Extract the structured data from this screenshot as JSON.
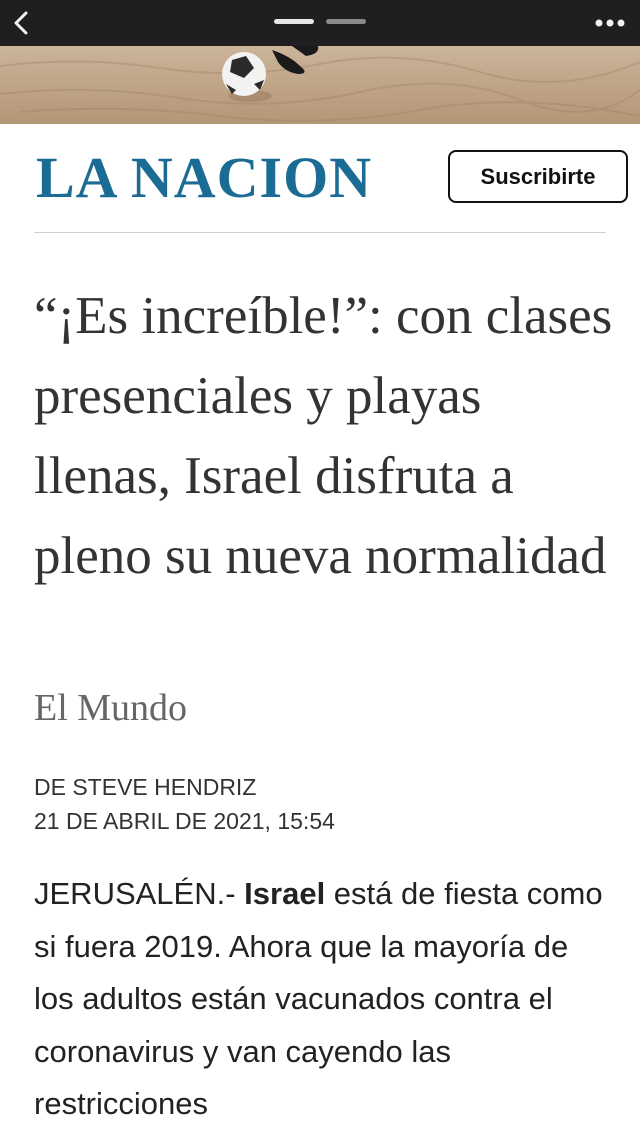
{
  "nav": {
    "back_icon": "chevron-left-icon",
    "more_icon": "ellipsis-icon",
    "pager_active_index": 1,
    "pager_count": 2
  },
  "masthead": {
    "logo": "LA NACION",
    "subscribe_label": "Suscribirte"
  },
  "article": {
    "headline": "“¡Es increíble!”: con clases presenciales y playas llenas, Israel disfruta a pleno su nueva normalidad",
    "section": "El Mundo",
    "author": "DE STEVE HENDRIZ",
    "date": "21 DE ABRIL DE 2021, 15:54",
    "body": {
      "lead": "JERUSALÉN.- ",
      "bold": "Israel",
      "rest": " está de fiesta como si fuera 2019. Ahora que la mayoría de los adultos están vacunados contra el coronavirus y van cayendo las restricciones"
    }
  },
  "colors": {
    "topbar": "#1f1f21",
    "logo": "#1b6c94",
    "section": "#666666"
  }
}
